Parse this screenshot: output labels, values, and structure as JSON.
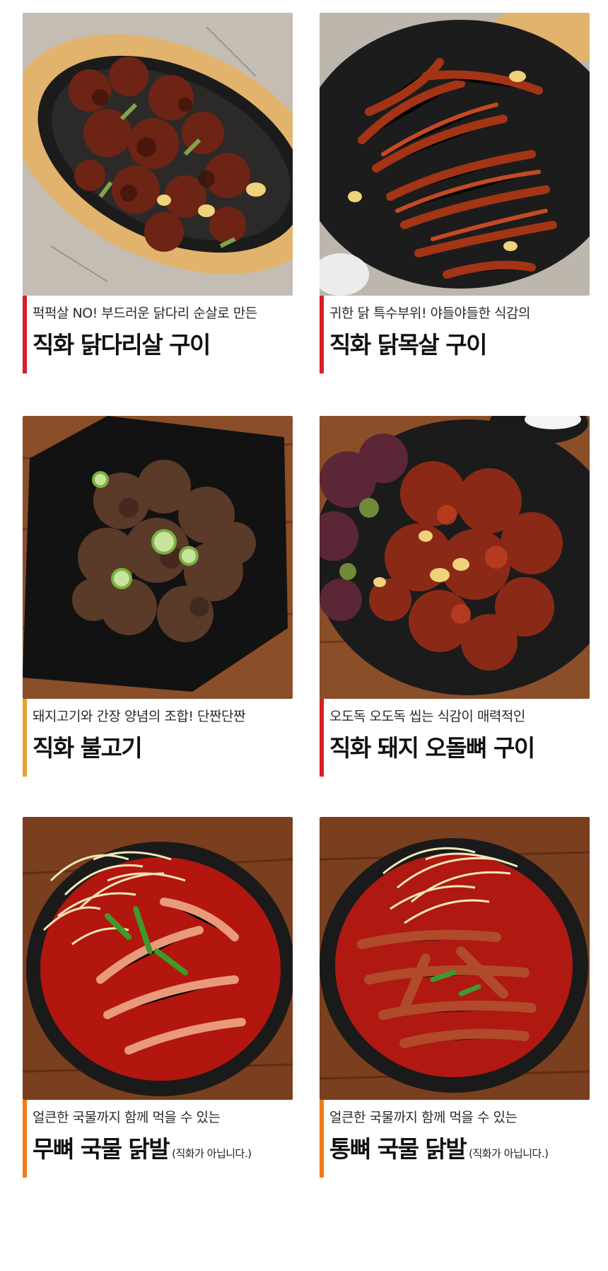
{
  "colors": {
    "bar_red": "#d61f26",
    "bar_orange": "#e8a02a",
    "bar_orange2": "#f27b16"
  },
  "cards": [
    {
      "subtitle": "퍽퍽살 NO! 부드러운 닭다리 순살로 만든",
      "title": "직화 닭다리살 구이",
      "note": ""
    },
    {
      "subtitle": "귀한 닭 특수부위! 야들야들한 식감의",
      "title": "직화 닭목살 구이",
      "note": ""
    },
    {
      "subtitle": "돼지고기와 간장 양념의 조합! 단짠단짠",
      "title": "직화 불고기",
      "note": ""
    },
    {
      "subtitle": "오도독 오도독 씹는 식감이 매력적인",
      "title": "직화 돼지 오돌뼈 구이",
      "note": ""
    },
    {
      "subtitle": "얼큰한 국물까지 함께 먹을 수 있는",
      "title": "무뼈 국물 닭발",
      "note": "(직화가 아닙니다.)"
    },
    {
      "subtitle": "얼큰한 국물까지 함께 먹을 수 있는",
      "title": "통뼈 국물 닭발",
      "note": "(직화가 아닙니다.)"
    }
  ]
}
